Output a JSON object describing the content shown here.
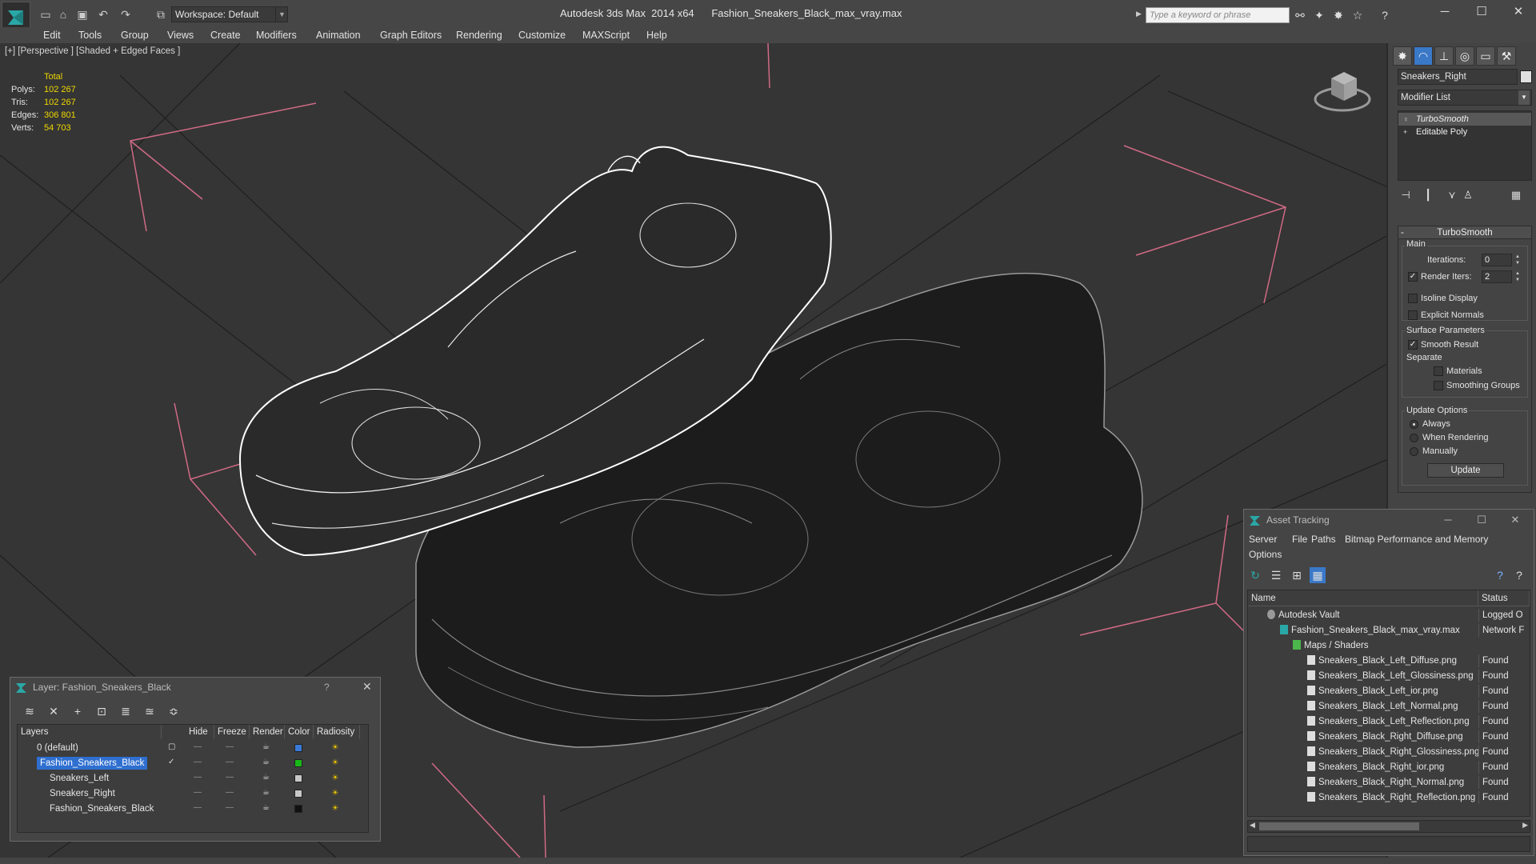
{
  "window": {
    "title": "Autodesk 3ds Max  2014 x64      Fashion_Sneakers_Black_max_vray.max",
    "workspace": "Workspace: Default",
    "search_placeholder": "Type a keyword or phrase"
  },
  "menu": [
    "Edit",
    "Tools",
    "Group",
    "Views",
    "Create",
    "Modifiers",
    "Animation",
    "Graph Editors",
    "Rendering",
    "Customize",
    "MAXScript",
    "Help"
  ],
  "viewport": {
    "label": "[+] [Perspective ] [Shaded + Edged Faces ]",
    "stats": {
      "header": "Total",
      "rows": [
        {
          "label": "Polys:",
          "value": "102 267"
        },
        {
          "label": "Tris:",
          "value": "102 267"
        },
        {
          "label": "Edges:",
          "value": "306 801"
        },
        {
          "label": "Verts:",
          "value": "54 703"
        }
      ]
    }
  },
  "command_panel": {
    "object_name": "Sneakers_Right",
    "modifier_list": "Modifier List",
    "stack": [
      "TurboSmooth",
      "Editable Poly"
    ],
    "rollout": {
      "title": "TurboSmooth",
      "main": "Main",
      "iterations_label": "Iterations:",
      "iterations": "0",
      "render_iters_label": "Render Iters:",
      "render_iters": "2",
      "isoline": "Isoline Display",
      "explicit_normals": "Explicit Normals",
      "surface_params": "Surface Parameters",
      "smooth_result": "Smooth Result",
      "separate": "Separate",
      "materials": "Materials",
      "smoothing_groups": "Smoothing Groups",
      "update_options": "Update Options",
      "always": "Always",
      "when_rendering": "When Rendering",
      "manually": "Manually",
      "update_button": "Update"
    }
  },
  "layer_dialog": {
    "title": "Layer: Fashion_Sneakers_Black",
    "help": "?",
    "columns": [
      "Layers",
      "Hide",
      "Freeze",
      "Render",
      "Color",
      "Radiosity"
    ],
    "rows": [
      {
        "name": "0 (default)",
        "color": "#3a7ad8"
      },
      {
        "name": "Fashion_Sneakers_Black",
        "color": "#18b818"
      },
      {
        "name": "Sneakers_Left",
        "color": "#c8c8c8"
      },
      {
        "name": "Sneakers_Right",
        "color": "#c8c8c8"
      },
      {
        "name": "Fashion_Sneakers_Black",
        "color": "#111111"
      }
    ]
  },
  "asset_dialog": {
    "title": "Asset Tracking",
    "menu": [
      "Server",
      "File",
      "Paths",
      "Bitmap Performance and Memory",
      "Options"
    ],
    "columns": [
      "Name",
      "Status"
    ],
    "rows": [
      {
        "name": "Autodesk Vault",
        "status": "Logged O"
      },
      {
        "name": "Fashion_Sneakers_Black_max_vray.max",
        "status": "Network F"
      },
      {
        "name": "Maps / Shaders",
        "status": ""
      },
      {
        "name": "Sneakers_Black_Left_Diffuse.png",
        "status": "Found"
      },
      {
        "name": "Sneakers_Black_Left_Glossiness.png",
        "status": "Found"
      },
      {
        "name": "Sneakers_Black_Left_ior.png",
        "status": "Found"
      },
      {
        "name": "Sneakers_Black_Left_Normal.png",
        "status": "Found"
      },
      {
        "name": "Sneakers_Black_Left_Reflection.png",
        "status": "Found"
      },
      {
        "name": "Sneakers_Black_Right_Diffuse.png",
        "status": "Found"
      },
      {
        "name": "Sneakers_Black_Right_Glossiness.png",
        "status": "Found"
      },
      {
        "name": "Sneakers_Black_Right_ior.png",
        "status": "Found"
      },
      {
        "name": "Sneakers_Black_Right_Normal.png",
        "status": "Found"
      },
      {
        "name": "Sneakers_Black_Right_Reflection.png",
        "status": "Found"
      }
    ]
  }
}
